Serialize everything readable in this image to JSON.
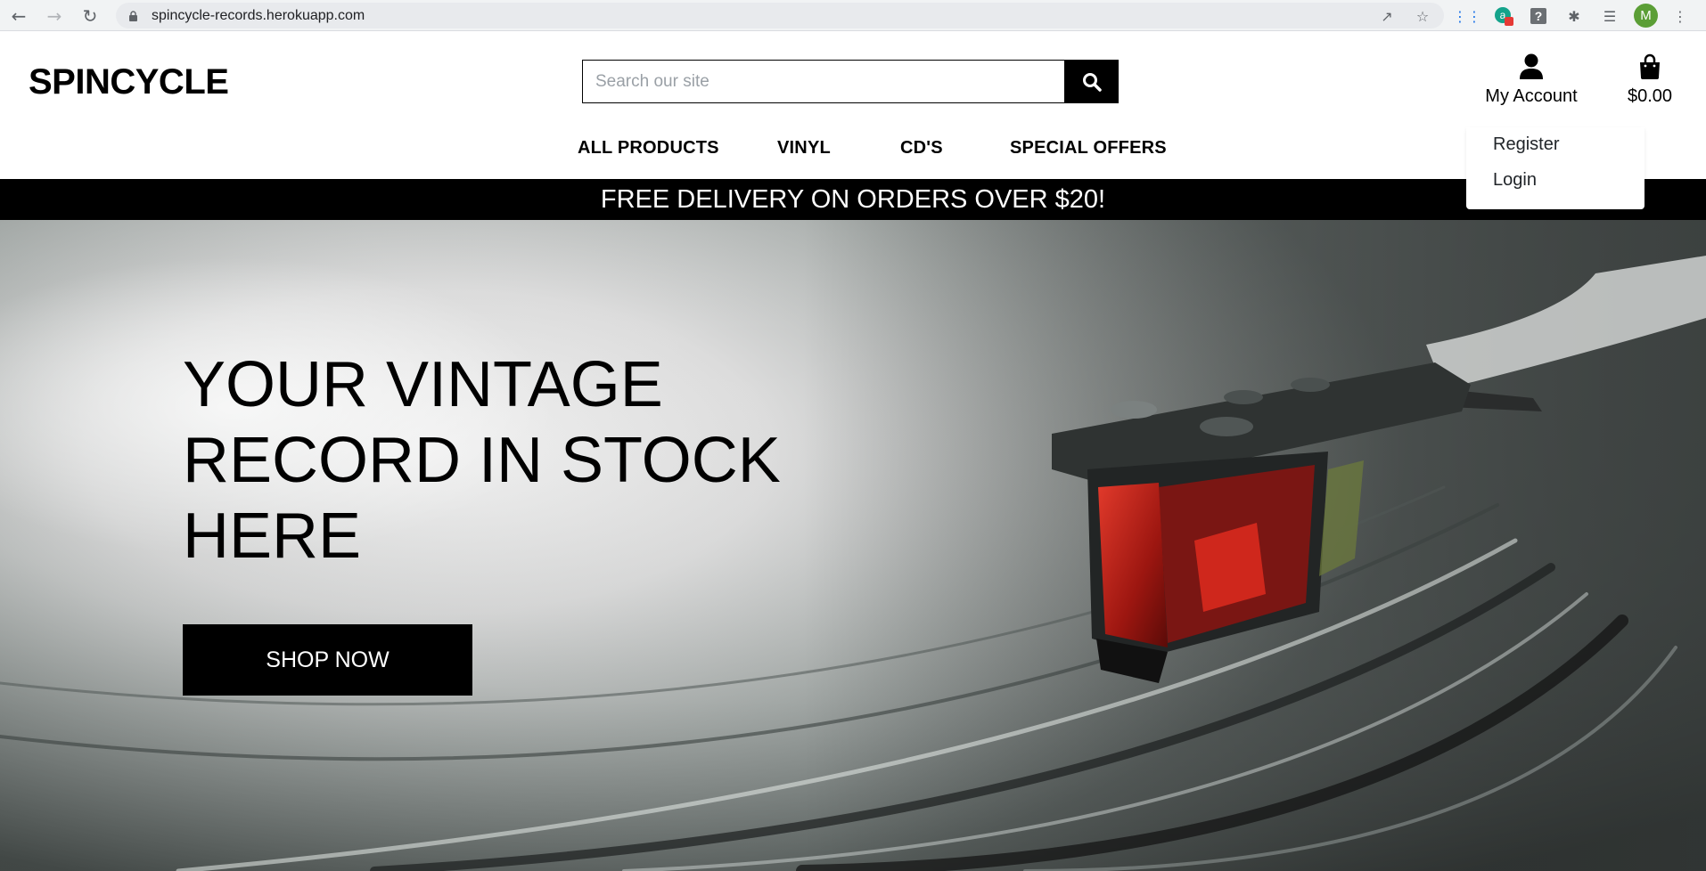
{
  "browser": {
    "url": "spincycle-records.herokuapp.com",
    "profile_initial": "M",
    "ext_badge": "1"
  },
  "header": {
    "logo": "SPINCYCLE",
    "search": {
      "placeholder": "Search our site"
    },
    "account_label": "My Account",
    "cart_total": "$0.00"
  },
  "nav": {
    "items": [
      {
        "label": "ALL PRODUCTS"
      },
      {
        "label": "VINYL"
      },
      {
        "label": "CD'S"
      },
      {
        "label": "SPECIAL OFFERS"
      }
    ]
  },
  "account_dropdown": {
    "items": [
      {
        "label": "Register"
      },
      {
        "label": "Login"
      }
    ]
  },
  "promo_banner": "FREE DELIVERY ON ORDERS OVER $20!",
  "hero": {
    "title": "YOUR VINTAGE RECORD IN STOCK HERE",
    "cta_label": "SHOP NOW"
  },
  "colors": {
    "primary": "#000000",
    "background": "#ffffff",
    "cartridge_red": "#b11a12"
  }
}
